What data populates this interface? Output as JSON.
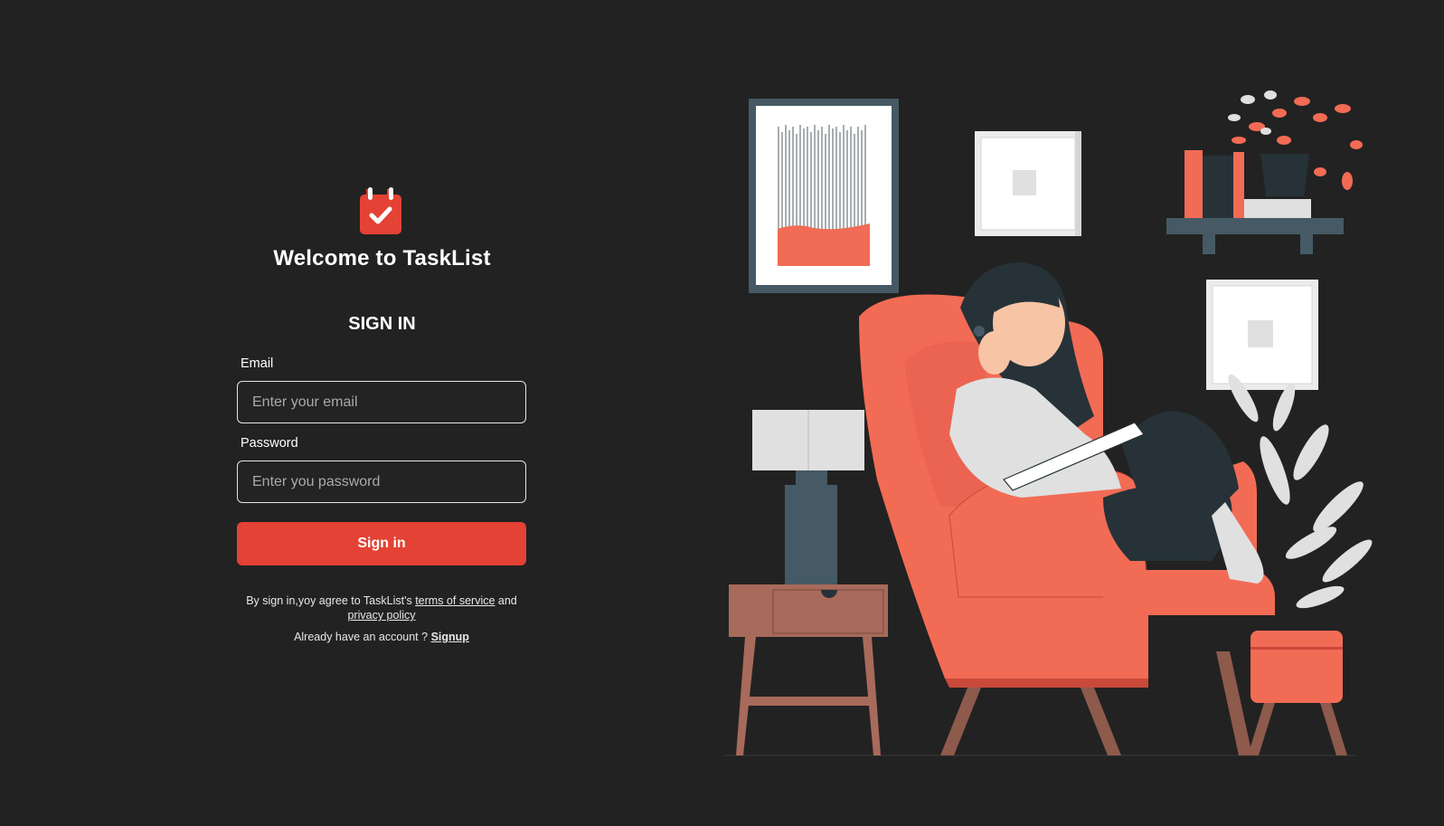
{
  "app": {
    "welcome_title": "Welcome to TaskList",
    "logo_icon": "calendar-check-icon",
    "brand_color": "#e34234",
    "background_color": "#222222"
  },
  "form": {
    "heading": "SIGN IN",
    "email_label": "Email",
    "email_placeholder": "Enter your email",
    "email_value": "",
    "password_label": "Password",
    "password_placeholder": "Enter you password",
    "password_value": "",
    "submit_label": "Sign in"
  },
  "terms": {
    "prefix": "By sign in,yoy agree to TaskList's ",
    "terms_link": "terms of service",
    "middle": " and",
    "privacy_link": "privacy policy"
  },
  "account": {
    "prompt": "Already have an account ? ",
    "signup_link": "Signup"
  },
  "illustration": {
    "subject": "woman-reading-in-armchair",
    "accent_color": "#f26b55",
    "dark_color": "#455a64"
  }
}
